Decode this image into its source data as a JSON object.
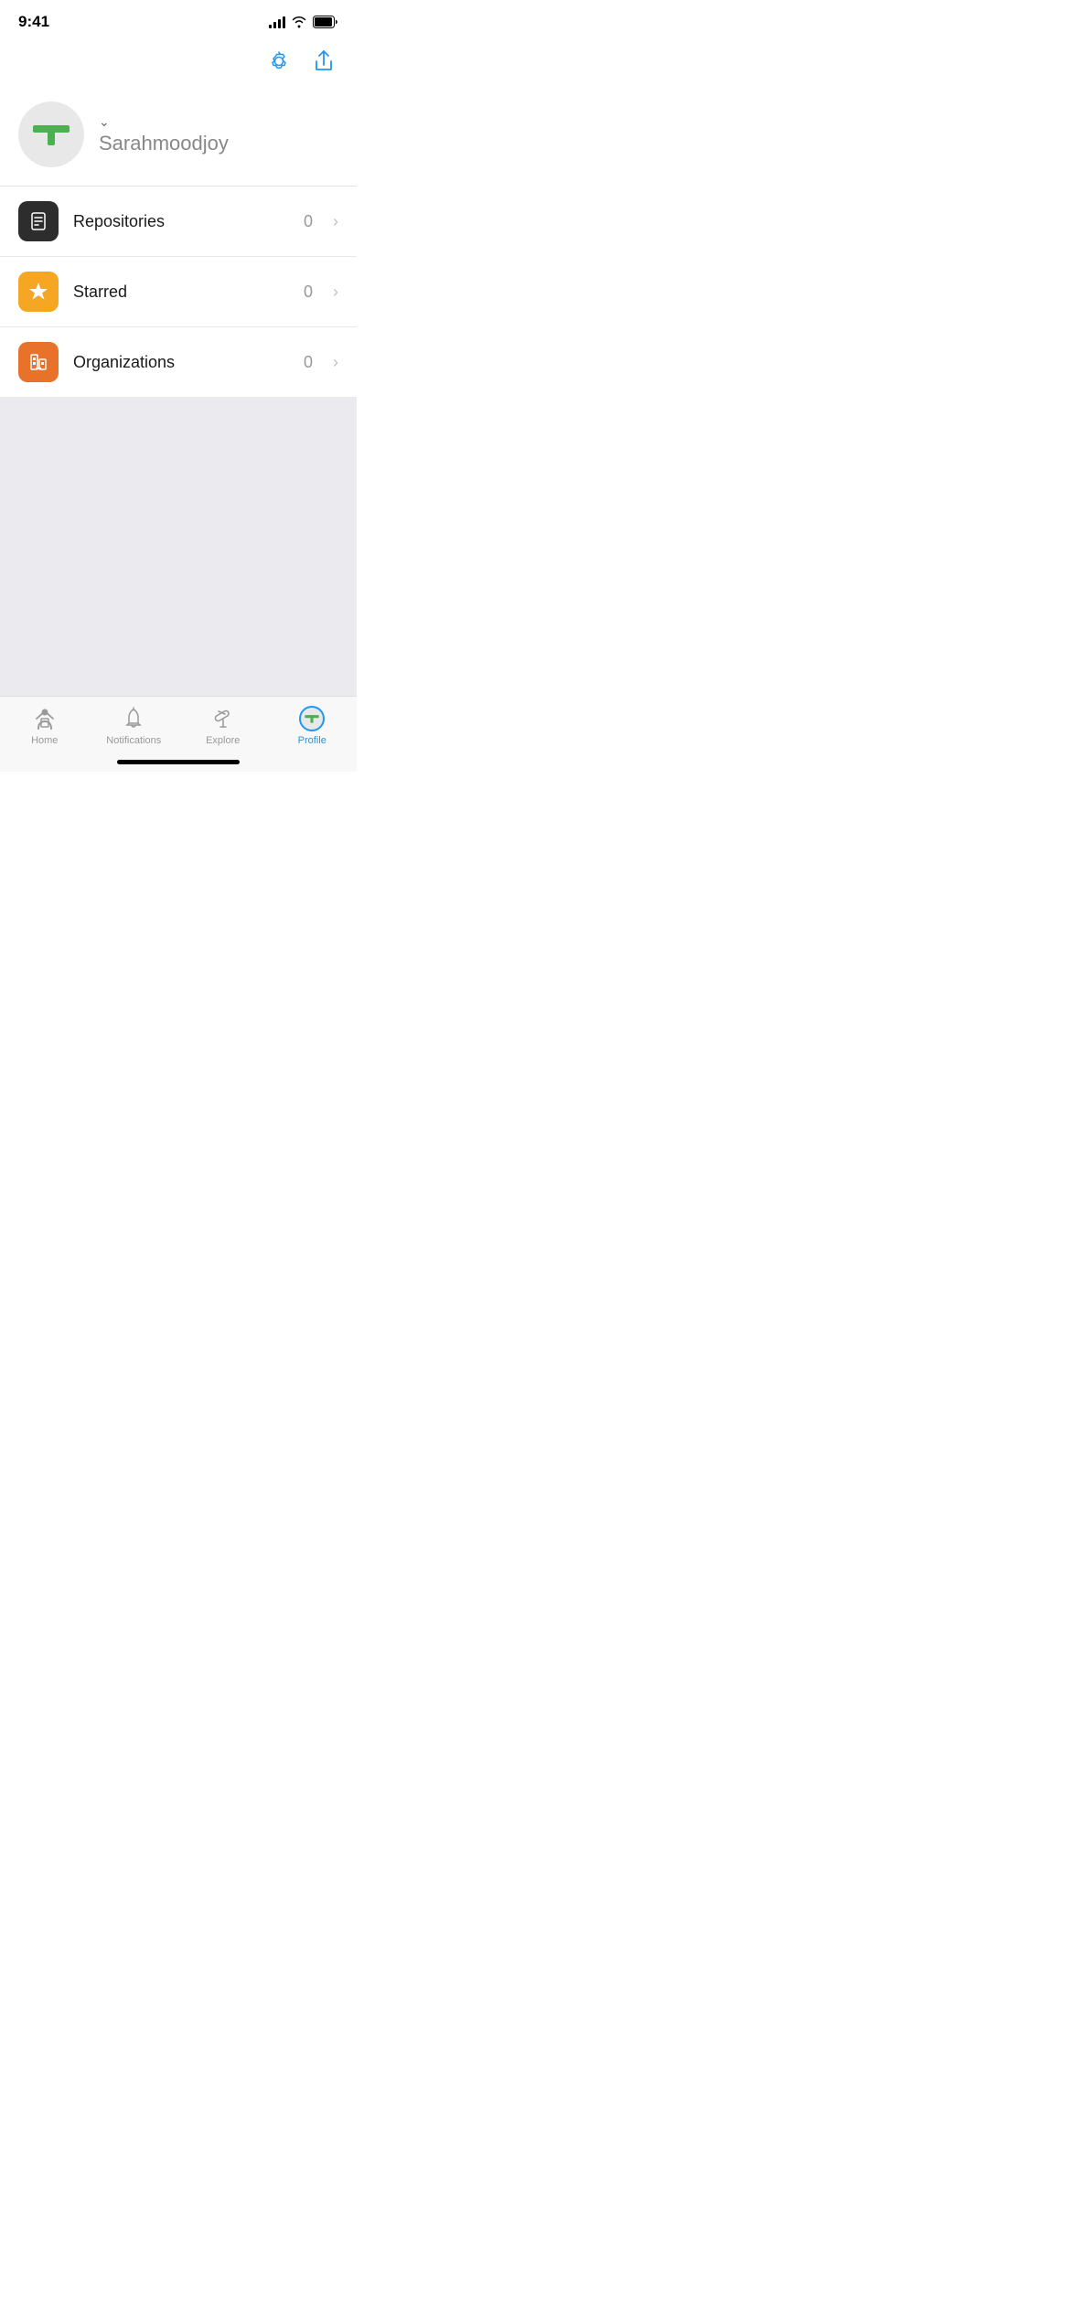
{
  "statusBar": {
    "time": "9:41"
  },
  "actionBar": {
    "settingsLabel": "Settings",
    "shareLabel": "Share"
  },
  "profile": {
    "username": "Sarahmoodjoy",
    "dropdownLabel": "Switch account"
  },
  "menuItems": [
    {
      "id": "repositories",
      "label": "Repositories",
      "count": "0",
      "iconStyle": "dark"
    },
    {
      "id": "starred",
      "label": "Starred",
      "count": "0",
      "iconStyle": "yellow"
    },
    {
      "id": "organizations",
      "label": "Organizations",
      "count": "0",
      "iconStyle": "orange"
    }
  ],
  "tabBar": {
    "tabs": [
      {
        "id": "home",
        "label": "Home",
        "active": false
      },
      {
        "id": "notifications",
        "label": "Notifications",
        "active": false
      },
      {
        "id": "explore",
        "label": "Explore",
        "active": false
      },
      {
        "id": "profile",
        "label": "Profile",
        "active": true
      }
    ]
  },
  "colors": {
    "blue": "#2196F3",
    "darkIcon": "#2d2d2d",
    "yellowIcon": "#f5a623",
    "orangeIcon": "#e8722a"
  }
}
